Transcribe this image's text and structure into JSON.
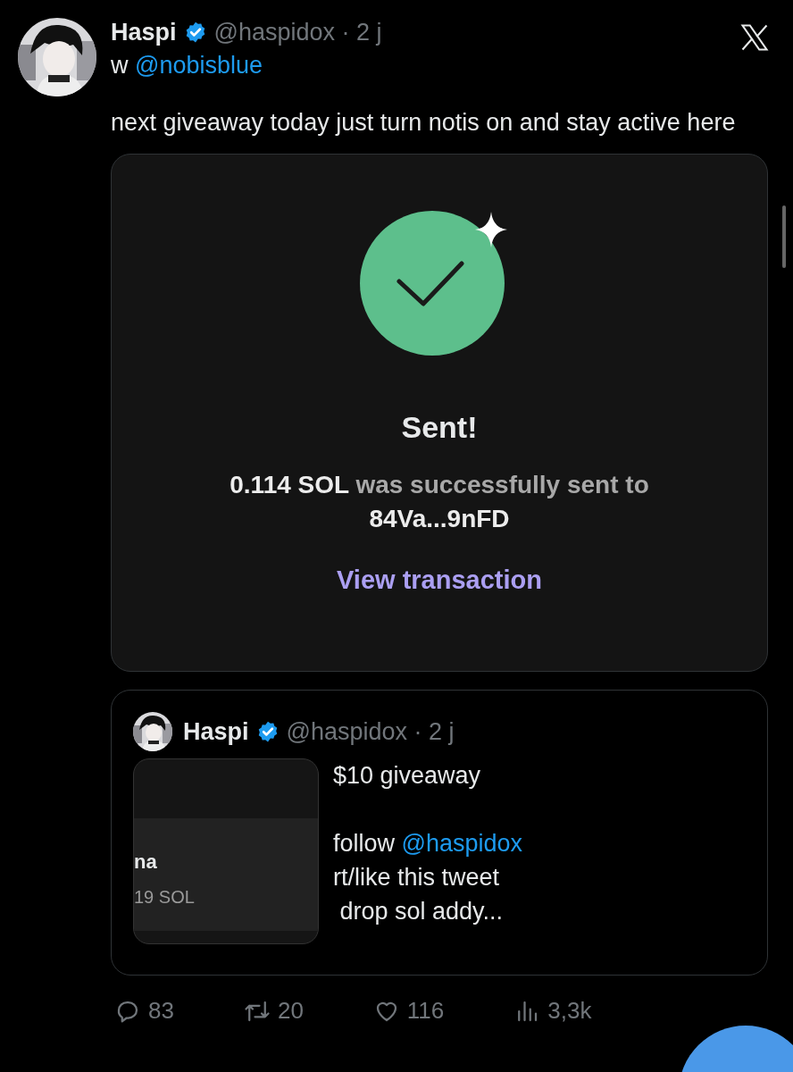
{
  "post": {
    "author": "Haspi",
    "verified": true,
    "handle": "@haspidox",
    "separator": "·",
    "time": "2 j",
    "reply_prefix": "w",
    "reply_mention": "@nobisblue",
    "text": "next giveaway today just turn notis on and stay active here"
  },
  "card": {
    "title": "Sent!",
    "amount": "0.114 SOL",
    "message": "was successfully sent to",
    "address": "84Va...9nFD",
    "link": "View transaction"
  },
  "quote": {
    "author": "Haspi",
    "verified": true,
    "handle": "@haspidox",
    "separator": "·",
    "time": "2 j",
    "thumbnail": {
      "line_1": "na",
      "line_2": "19 SOL"
    },
    "lines": [
      {
        "kind": "text",
        "text": "$10 giveaway"
      },
      {
        "kind": "blank"
      },
      {
        "kind": "mention",
        "text": "follow",
        "mention": "@haspidox"
      },
      {
        "kind": "text",
        "text": "rt/like this tweet"
      },
      {
        "kind": "text",
        "text": " drop sol addy..."
      }
    ]
  },
  "actions": [
    {
      "kind": "reply",
      "count": "83"
    },
    {
      "kind": "repost",
      "count": "20"
    },
    {
      "kind": "like",
      "count": "116"
    },
    {
      "kind": "views",
      "count": "3,3k"
    }
  ]
}
